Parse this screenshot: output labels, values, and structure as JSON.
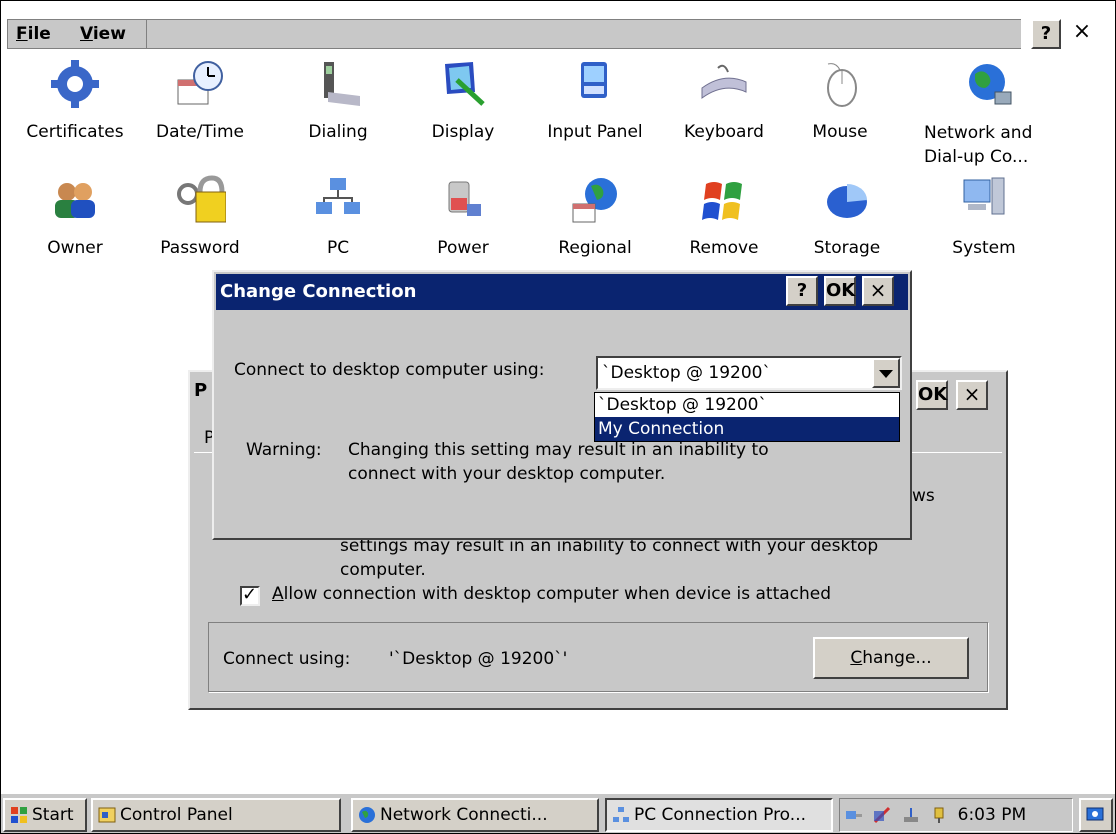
{
  "menu": {
    "file": "File",
    "view": "View",
    "help_btn": "?",
    "close_btn": "×"
  },
  "icons": {
    "row1": [
      "Certificates",
      "Date/Time",
      "Dialing",
      "Display",
      "Input Panel",
      "Keyboard",
      "Mouse"
    ],
    "network_line1": "Network and",
    "network_line2": "Dial-up Co...",
    "row2": [
      "Owner",
      "Password",
      "PC",
      "Power",
      "Regional",
      "Remove",
      "Storage",
      "System"
    ]
  },
  "pc_window": {
    "title_fragment": "P",
    "tab_fragment": "P",
    "ok": "OK",
    "close": "×",
    "fragment_ws": "ws",
    "text_line1": "settings may result in an inability to connect with your desktop",
    "text_line2": "computer.",
    "allow_label": "Allow connection with desktop computer when device is attached",
    "allow_checked": "✓",
    "connect_using_label": "Connect using:",
    "connect_using_value": "'`Desktop @ 19200`'",
    "change_button": "Change..."
  },
  "dialog": {
    "title": "Change Connection",
    "help": "?",
    "ok": "OK",
    "close": "×",
    "connect_label": "Connect to desktop computer using:",
    "selected": "`Desktop @ 19200`",
    "options": [
      "`Desktop @ 19200`",
      "My Connection"
    ],
    "warning_label": "Warning:",
    "warning_line1": "Changing this setting may result in an inability to",
    "warning_line2": "connect with your desktop computer."
  },
  "taskbar": {
    "start": "Start",
    "items": [
      "Control Panel",
      "Network Connecti...",
      "PC Connection Pro..."
    ],
    "time": "6:03 PM"
  },
  "colors": {
    "titlebar": "#0a2470",
    "face": "#c8c8c8"
  }
}
